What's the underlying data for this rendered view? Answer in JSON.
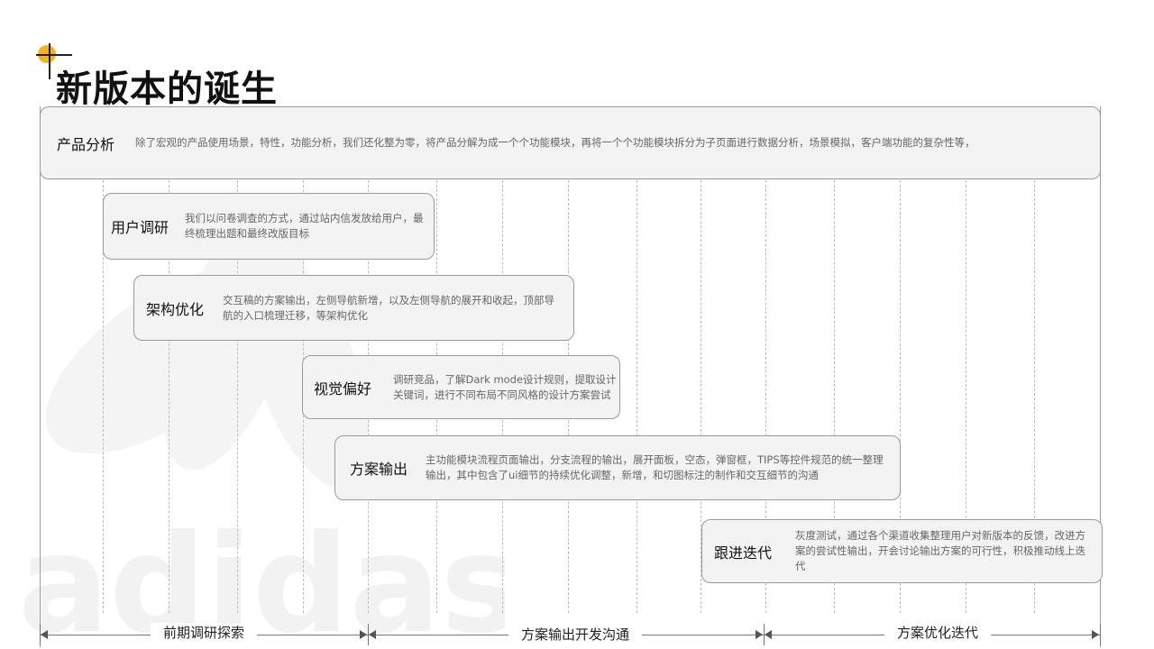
{
  "title": "新版本的诞生",
  "watermark": {
    "text": "adidas",
    "color": "#f4f4f4"
  },
  "accent_color": "#f5b324",
  "steps": [
    {
      "label": "产品分析",
      "description": "除了宏观的产品使用场景，特性，功能分析，我们还化整为零，将产品分解为成一个个功能模块，再将一个个功能模块拆分为子页面进行数据分析，场景模拟，客户端功能的复杂性等，"
    },
    {
      "label": "用户调研",
      "description": "我们以问卷调查的方式，通过站内信发放给用户，最终梳理出题和最终改版目标"
    },
    {
      "label": "架构优化",
      "description": "交互稿的方案输出，左侧导航新增，以及左侧导航的展开和收起，顶部导航的入口梳理迁移，等架构优化"
    },
    {
      "label": "视觉偏好",
      "description": "调研竞品，了解Dark  mode设计规则，提取设计关键词，进行不同布局不同风格的设计方案尝试"
    },
    {
      "label": "方案输出",
      "description": "主功能模块流程页面输出，分支流程的输出，展开面板，空态，弹窗框，TIPS等控件规范的统一整理输出，其中包含了ui细节的持续优化调整，新增，和切图标注的制作和交互细节的沟通"
    },
    {
      "label": "跟进迭代",
      "description": "灰度测试，通过各个渠道收集整理用户对新版本的反馈，改进方案的尝试性输出，开会讨论输出方案的可行性，积极推动线上迭代"
    }
  ],
  "phases": [
    {
      "label": "前期调研探索"
    },
    {
      "label": "方案输出开发沟通"
    },
    {
      "label": "方案优化迭代"
    }
  ]
}
